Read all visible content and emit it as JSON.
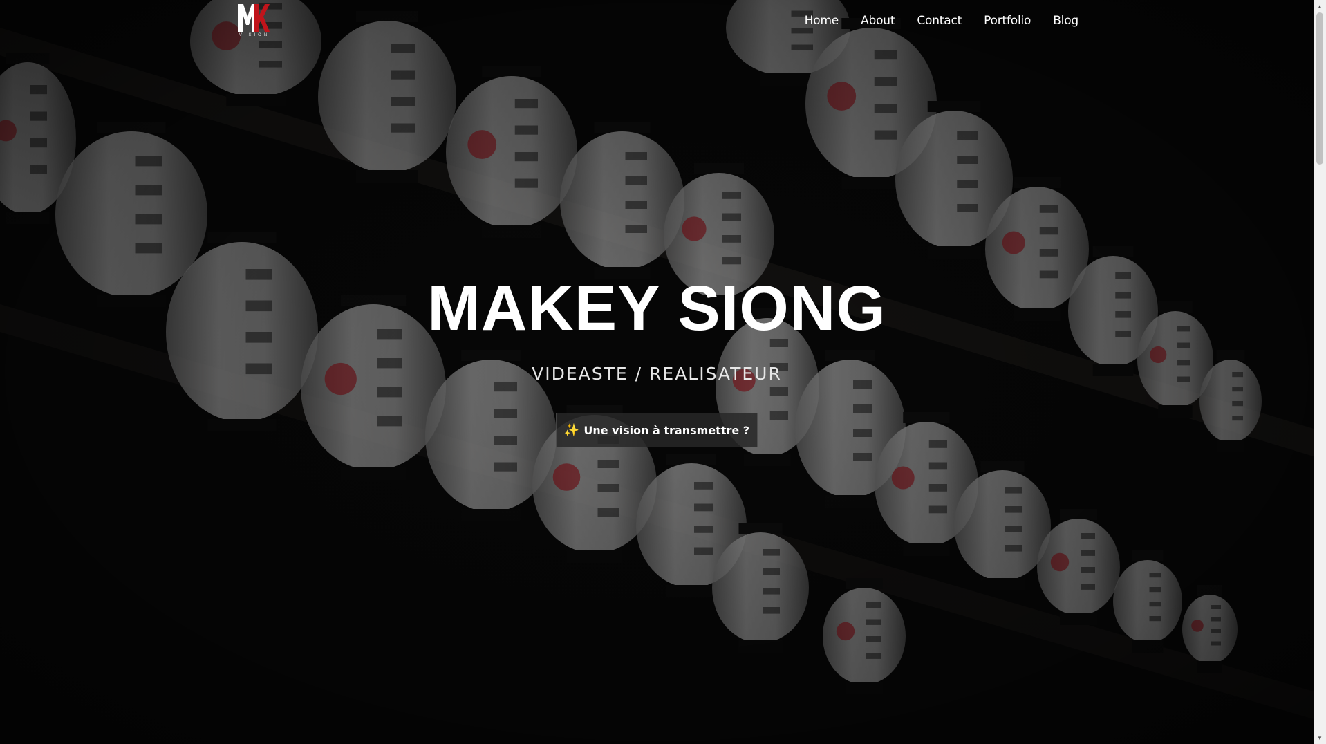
{
  "brand": {
    "logo_text": "MK",
    "logo_sub": "VISION",
    "colors": {
      "logo_white": "#ffffff",
      "logo_red": "#c0141b"
    }
  },
  "nav": {
    "items": [
      {
        "label": "Home"
      },
      {
        "label": "About"
      },
      {
        "label": "Contact"
      },
      {
        "label": "Portfolio"
      },
      {
        "label": "Blog"
      }
    ]
  },
  "hero": {
    "title": "MAKEY SIONG",
    "subtitle": "VIDEASTE / REALISATEUR",
    "cta": {
      "icon": "sparkles-icon",
      "label": "Une vision à transmettre ?"
    },
    "background": "paper-lanterns-photo"
  },
  "colors": {
    "background": "#000000",
    "text": "#ffffff",
    "cta_background": "#282828",
    "lantern_white": "#d8d8d8",
    "lantern_red": "#b2202a"
  }
}
